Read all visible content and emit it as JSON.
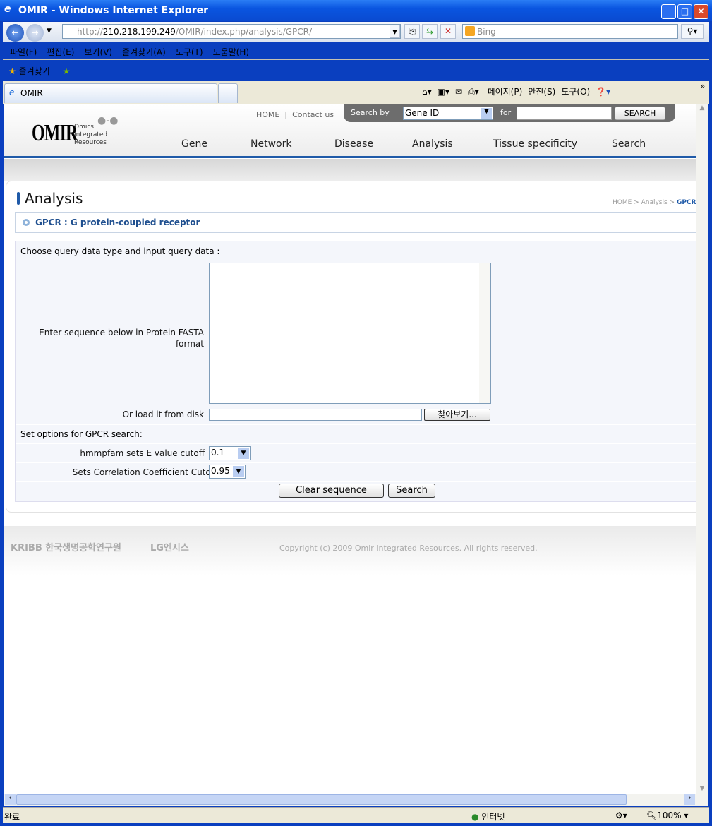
{
  "window": {
    "title": "OMIR - Windows Internet Explorer"
  },
  "address": {
    "url_prefix": "http://",
    "url_host": "210.218.199.249",
    "url_path": "/OMIR/index.php/analysis/GPCR/",
    "search_placeholder": "Bing"
  },
  "menu": [
    "파일(F)",
    "편집(E)",
    "보기(V)",
    "즐겨찾기(A)",
    "도구(T)",
    "도움말(H)"
  ],
  "favorites": {
    "label": "즐겨찾기"
  },
  "tab": {
    "label": "OMIR"
  },
  "commandbar": [
    "페이지(P)",
    "안전(S)",
    "도구(O)"
  ],
  "site": {
    "logo": "OMIR",
    "logo_sub": [
      "Omics",
      "Integrated",
      "Resources"
    ],
    "top_links": [
      "HOME",
      "Contact us"
    ],
    "search_by_label": "Search by",
    "search_by_value": "Gene ID",
    "for_label": "for",
    "search_input": "",
    "search_button": "SEARCH",
    "nav": [
      "Gene",
      "Network",
      "Disease",
      "Analysis",
      "Tissue specificity",
      "Search"
    ],
    "page_title": "Analysis",
    "breadcrumb": {
      "home": "HOME",
      "sep": " > ",
      "section": "Analysis",
      "current": "GPCR"
    },
    "subtitle": "GPCR : G protein-coupled receptor",
    "form": {
      "section1": "Choose query data type and input query data :",
      "sequence_label": "Enter sequence below in Protein FASTA format",
      "sequence_value": "",
      "file_label": "Or load it from disk",
      "file_value": "",
      "browse_button": "찾아보기...",
      "section2": "Set options for GPCR search:",
      "evalue_label": "hmmpfam sets E value cutoff",
      "evalue_value": "0.1",
      "corr_label": "Sets Correlation Coefficient Cutoff",
      "corr_value": "0.95",
      "clear_button": "Clear sequence",
      "search_button": "Search"
    },
    "footer": {
      "krib": "KRIBB 한국생명공학연구원",
      "lg": "LG엔시스",
      "copyright": "Copyright (c) 2009 Omir Integrated Resources. All rights reserved."
    }
  },
  "status": {
    "text": "완료",
    "zone": "인터넷",
    "zoom": "100%"
  },
  "colors": {
    "accent": "#1f5aa8",
    "title_bar": "#0a55e0",
    "subtitle": "#1f4f8f"
  }
}
